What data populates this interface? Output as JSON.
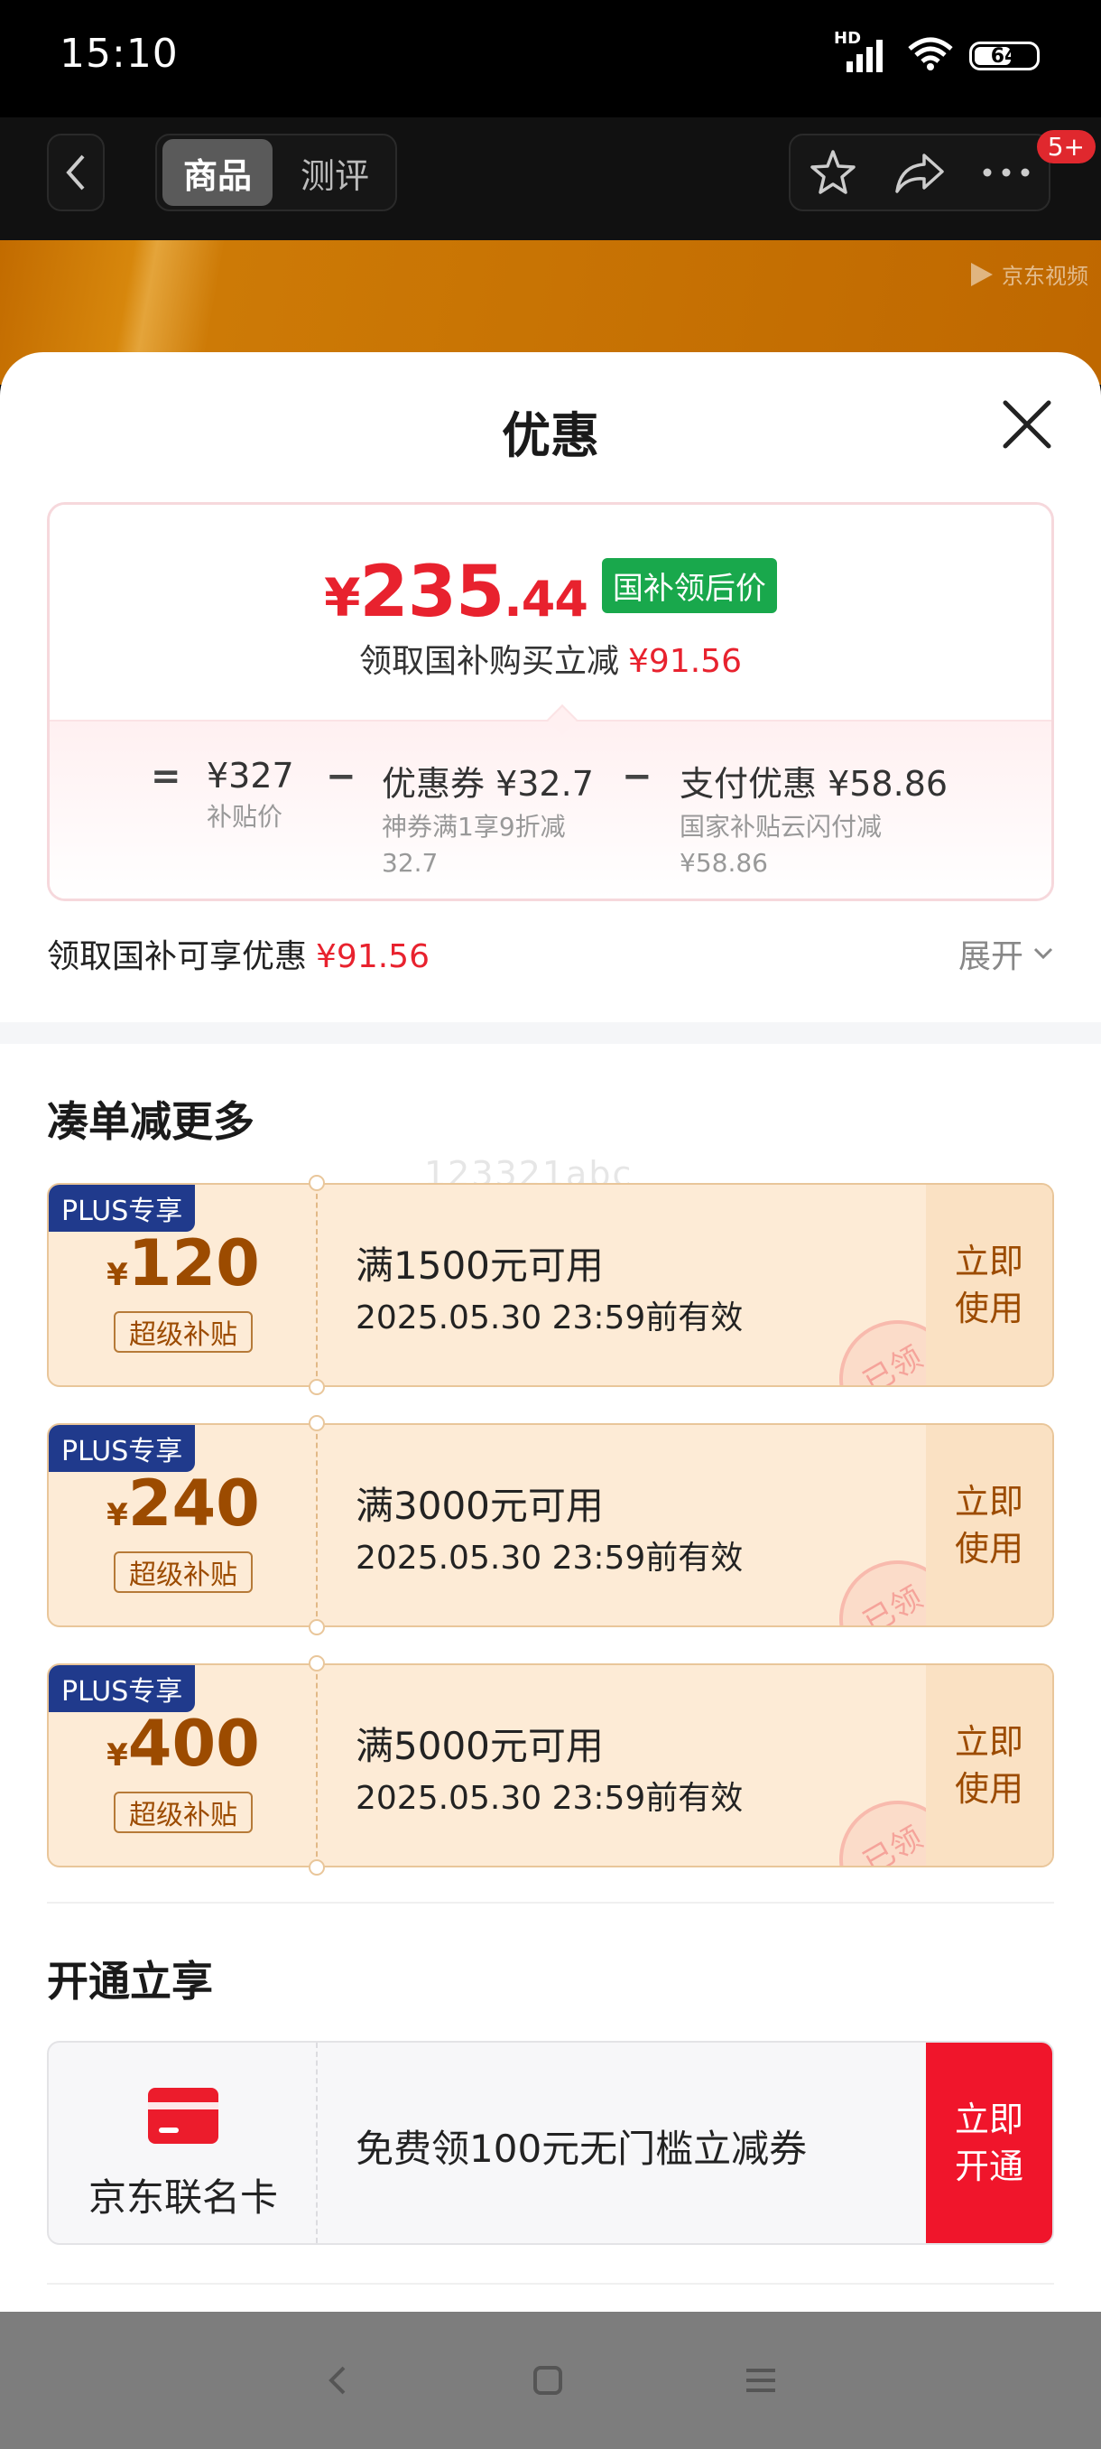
{
  "status_bar": {
    "time": "15:10",
    "battery": "64",
    "network": "HD"
  },
  "nav": {
    "tabs": [
      {
        "label": "商品",
        "active": true
      },
      {
        "label": "测评",
        "active": false
      }
    ],
    "badge": "5+"
  },
  "banner": {
    "brand": "京东视频"
  },
  "sheet": {
    "title": "优惠",
    "price": {
      "currency": "¥",
      "integer": "235",
      "decimal": ".44",
      "tag": "国补领后价",
      "sub_label": "领取国补购买立减",
      "sub_amount": "¥91.56"
    },
    "calc": {
      "eq": "=",
      "minus": "−",
      "items": [
        {
          "value": "¥327",
          "desc": "补贴价"
        },
        {
          "value": "优惠券 ¥32.7",
          "desc1": "神券满1享9折减",
          "desc2": "32.7"
        },
        {
          "value": "支付优惠 ¥58.86",
          "desc1": "国家补贴云闪付减",
          "desc2": "¥58.86"
        }
      ]
    },
    "discount_row": {
      "label": "领取国补可享优惠",
      "amount": "¥91.56",
      "expand": "展开"
    },
    "section_more": "凑单减更多",
    "watermark": "123321abc",
    "coupons": [
      {
        "tag": "PLUS专享",
        "currency": "¥",
        "amount": "120",
        "badge": "超级补贴",
        "condition": "满1500元可用",
        "expiry": "2025.05.30 23:59前有效",
        "action_line1": "立即",
        "action_line2": "使用",
        "stamp": "已领"
      },
      {
        "tag": "PLUS专享",
        "currency": "¥",
        "amount": "240",
        "badge": "超级补贴",
        "condition": "满3000元可用",
        "expiry": "2025.05.30 23:59前有效",
        "action_line1": "立即",
        "action_line2": "使用",
        "stamp": "已领"
      },
      {
        "tag": "PLUS专享",
        "currency": "¥",
        "amount": "400",
        "badge": "超级补贴",
        "condition": "满5000元可用",
        "expiry": "2025.05.30 23:59前有效",
        "action_line1": "立即",
        "action_line2": "使用",
        "stamp": "已领"
      }
    ],
    "section_open": "开通立享",
    "card_promo": {
      "name": "京东联名卡",
      "text": "免费领100元无门槛立减券",
      "action_line1": "立即",
      "action_line2": "开通"
    }
  },
  "colors": {
    "accent_red": "#e8222e",
    "coupon_brown": "#9c4b00",
    "plus_blue": "#203a8c",
    "green_tag": "#19a84c"
  }
}
